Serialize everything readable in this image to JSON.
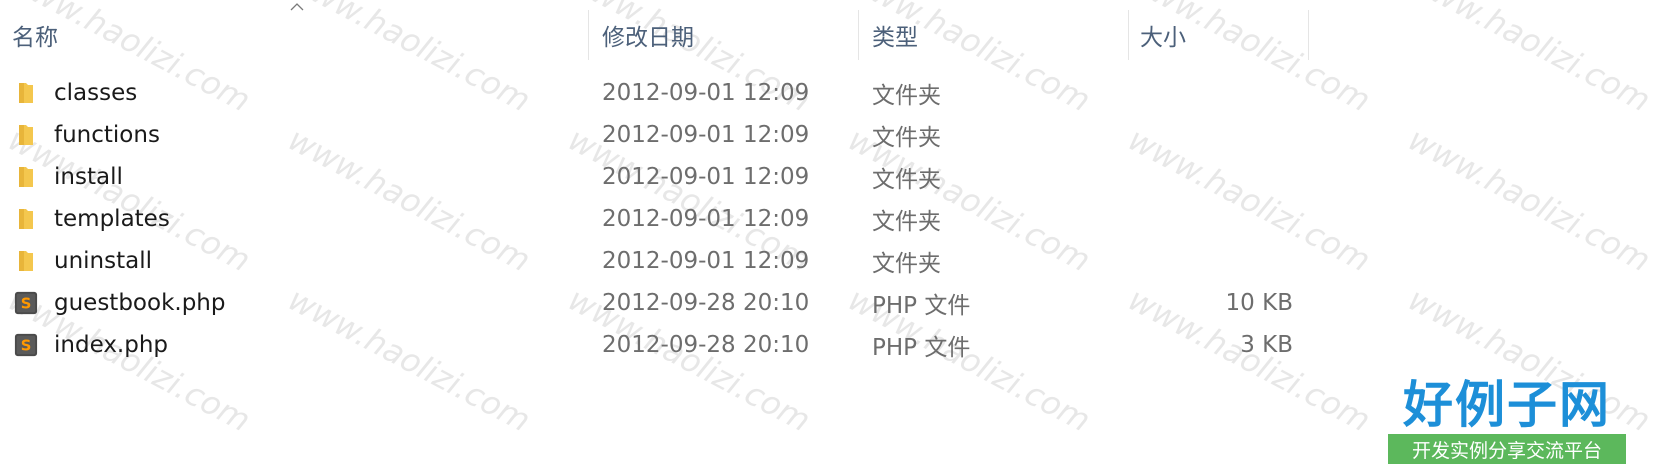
{
  "columns": {
    "name": "名称",
    "modified": "修改日期",
    "type": "类型",
    "size": "大小"
  },
  "files": [
    {
      "name": "classes",
      "modified": "2012-09-01 12:09",
      "type": "文件夹",
      "size": "",
      "icon": "folder-icon"
    },
    {
      "name": "functions",
      "modified": "2012-09-01 12:09",
      "type": "文件夹",
      "size": "",
      "icon": "folder-icon"
    },
    {
      "name": "install",
      "modified": "2012-09-01 12:09",
      "type": "文件夹",
      "size": "",
      "icon": "folder-icon"
    },
    {
      "name": "templates",
      "modified": "2012-09-01 12:09",
      "type": "文件夹",
      "size": "",
      "icon": "folder-icon"
    },
    {
      "name": "uninstall",
      "modified": "2012-09-01 12:09",
      "type": "文件夹",
      "size": "",
      "icon": "folder-icon"
    },
    {
      "name": "guestbook.php",
      "modified": "2012-09-28 20:10",
      "type": "PHP 文件",
      "size": "10 KB",
      "icon": "sublime-file-icon"
    },
    {
      "name": "index.php",
      "modified": "2012-09-28 20:10",
      "type": "PHP 文件",
      "size": "3 KB",
      "icon": "sublime-file-icon"
    }
  ],
  "watermark": "www.haolizi.com",
  "logo": {
    "title": "好例子网",
    "subtitle": "开发实例分享交流平台"
  },
  "colors": {
    "header_text": "#4c607a",
    "folder": "#f4c74e",
    "logo_blue": "#1d8fd8",
    "logo_green": "#5cb85c"
  }
}
